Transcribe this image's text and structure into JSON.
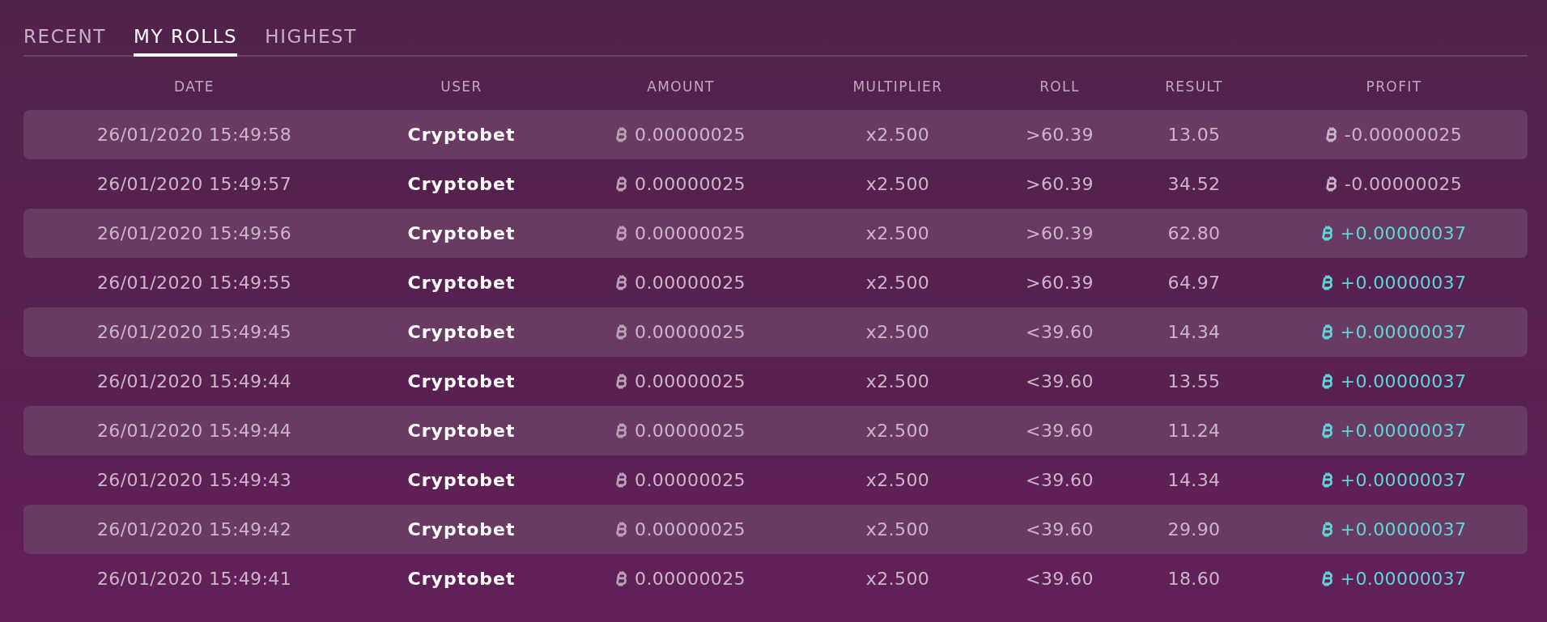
{
  "tabs": [
    {
      "label": "RECENT",
      "selected": false
    },
    {
      "label": "MY ROLLS",
      "selected": true
    },
    {
      "label": "HIGHEST",
      "selected": false
    }
  ],
  "table": {
    "columns": [
      "DATE",
      "USER",
      "AMOUNT",
      "MULTIPLIER",
      "ROLL",
      "RESULT",
      "PROFIT"
    ],
    "rows": [
      {
        "date": "26/01/2020 15:49:58",
        "user": "Cryptobet",
        "amount": "0.00000025",
        "multiplier": "x2.500",
        "roll": ">60.39",
        "result": "13.05",
        "profit": "-0.00000025",
        "kind": "loss"
      },
      {
        "date": "26/01/2020 15:49:57",
        "user": "Cryptobet",
        "amount": "0.00000025",
        "multiplier": "x2.500",
        "roll": ">60.39",
        "result": "34.52",
        "profit": "-0.00000025",
        "kind": "loss"
      },
      {
        "date": "26/01/2020 15:49:56",
        "user": "Cryptobet",
        "amount": "0.00000025",
        "multiplier": "x2.500",
        "roll": ">60.39",
        "result": "62.80",
        "profit": "+0.00000037",
        "kind": "win"
      },
      {
        "date": "26/01/2020 15:49:55",
        "user": "Cryptobet",
        "amount": "0.00000025",
        "multiplier": "x2.500",
        "roll": ">60.39",
        "result": "64.97",
        "profit": "+0.00000037",
        "kind": "win"
      },
      {
        "date": "26/01/2020 15:49:45",
        "user": "Cryptobet",
        "amount": "0.00000025",
        "multiplier": "x2.500",
        "roll": "<39.60",
        "result": "14.34",
        "profit": "+0.00000037",
        "kind": "win"
      },
      {
        "date": "26/01/2020 15:49:44",
        "user": "Cryptobet",
        "amount": "0.00000025",
        "multiplier": "x2.500",
        "roll": "<39.60",
        "result": "13.55",
        "profit": "+0.00000037",
        "kind": "win"
      },
      {
        "date": "26/01/2020 15:49:44",
        "user": "Cryptobet",
        "amount": "0.00000025",
        "multiplier": "x2.500",
        "roll": "<39.60",
        "result": "11.24",
        "profit": "+0.00000037",
        "kind": "win"
      },
      {
        "date": "26/01/2020 15:49:43",
        "user": "Cryptobet",
        "amount": "0.00000025",
        "multiplier": "x2.500",
        "roll": "<39.60",
        "result": "14.34",
        "profit": "+0.00000037",
        "kind": "win"
      },
      {
        "date": "26/01/2020 15:49:42",
        "user": "Cryptobet",
        "amount": "0.00000025",
        "multiplier": "x2.500",
        "roll": "<39.60",
        "result": "29.90",
        "profit": "+0.00000037",
        "kind": "win"
      },
      {
        "date": "26/01/2020 15:49:41",
        "user": "Cryptobet",
        "amount": "0.00000025",
        "multiplier": "x2.500",
        "roll": "<39.60",
        "result": "18.60",
        "profit": "+0.00000037",
        "kind": "win"
      }
    ]
  }
}
